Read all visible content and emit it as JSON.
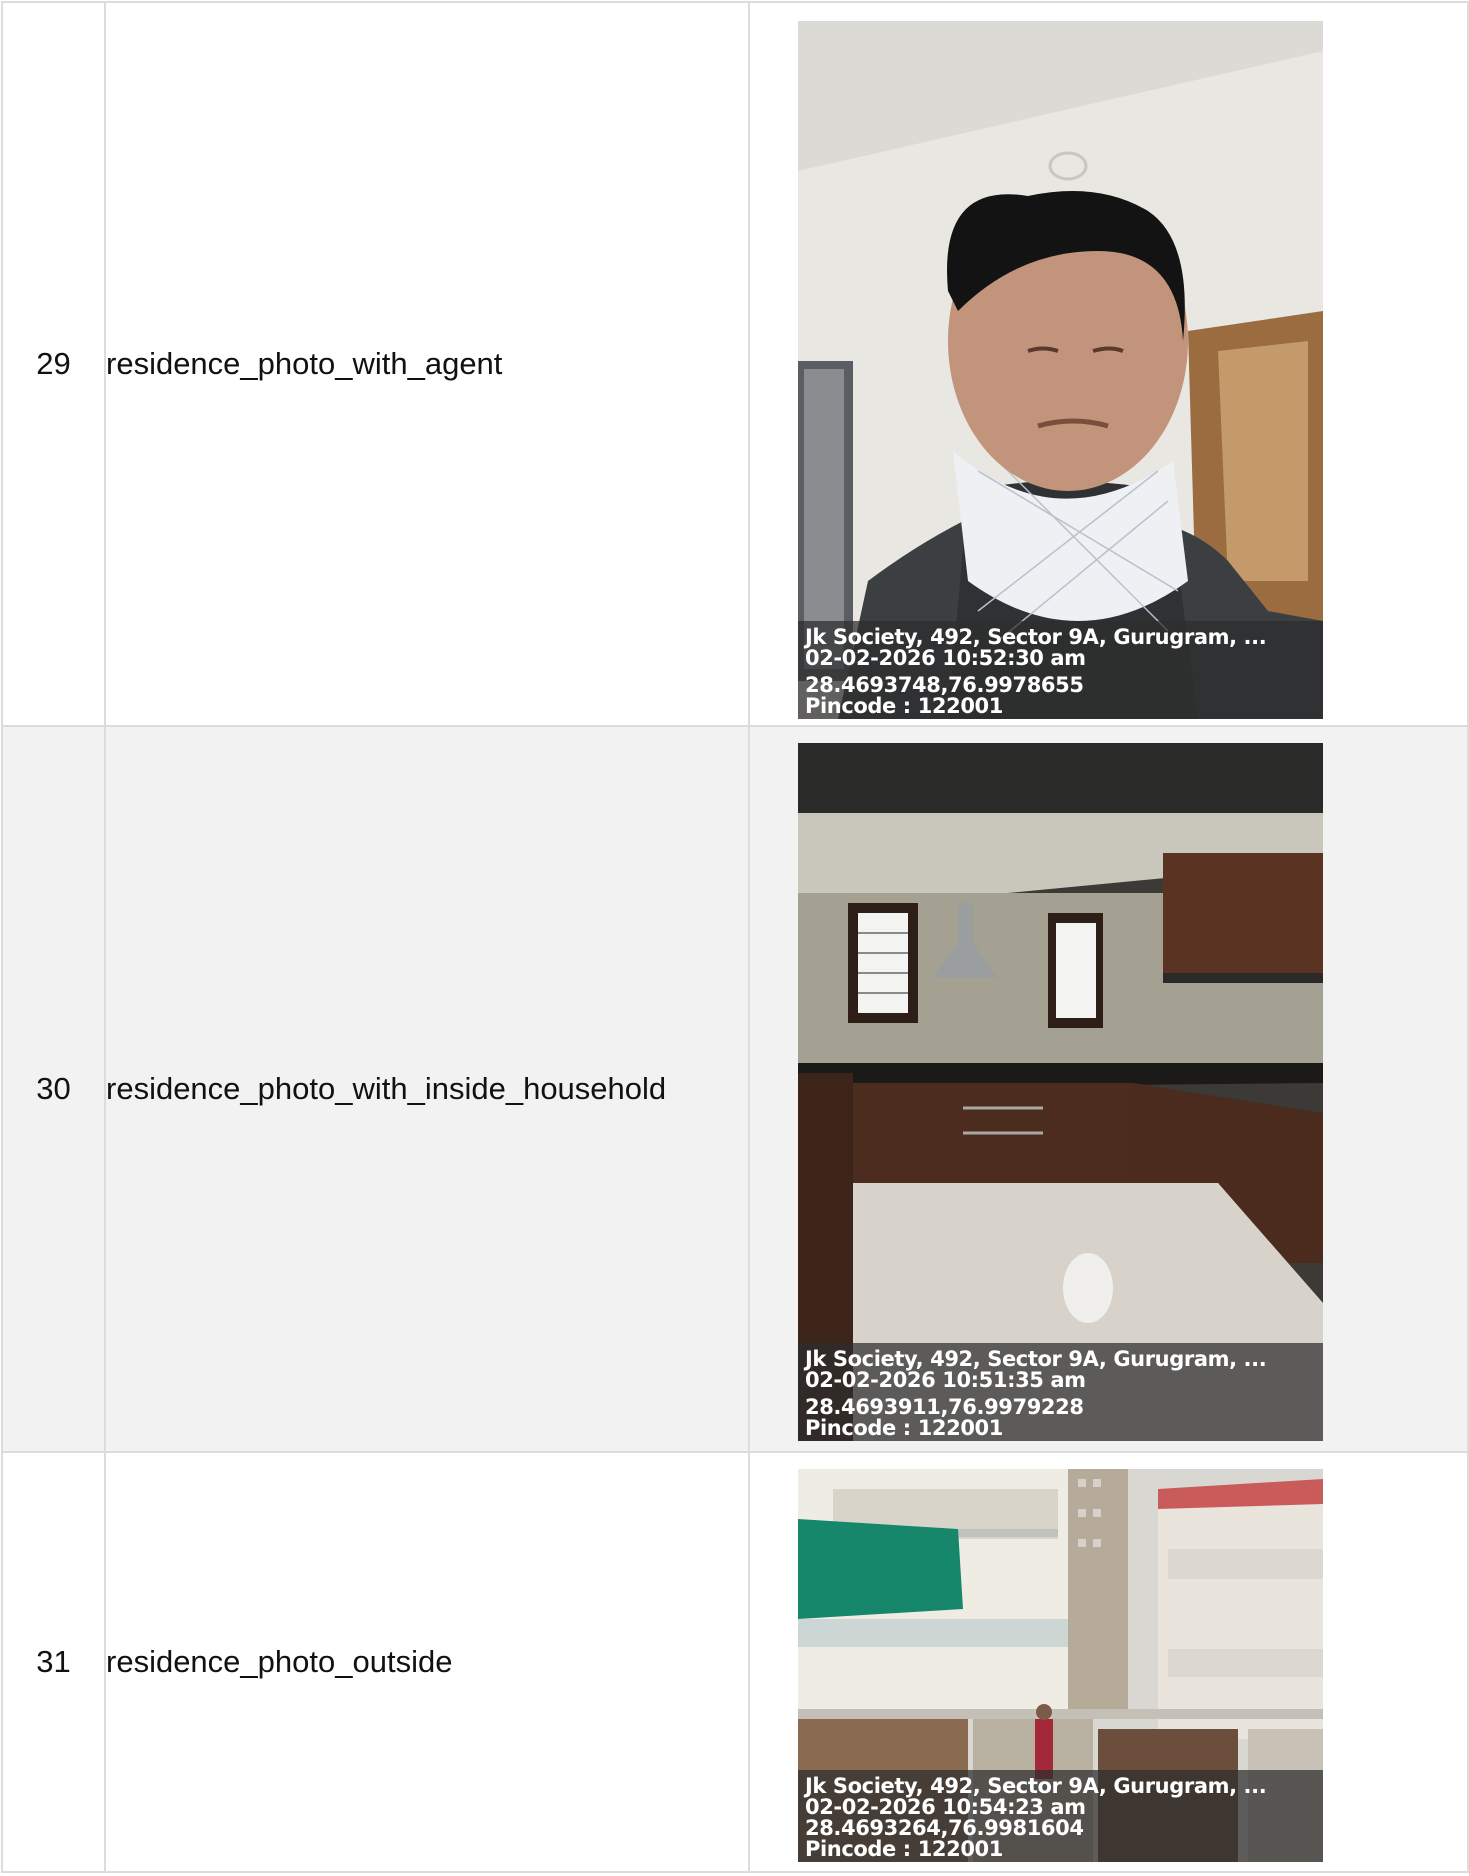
{
  "rows": [
    {
      "index": "29",
      "label": "residence_photo_with_agent",
      "stamp": {
        "address": "Jk Society, 492, Sector 9A, Gurugram, ...",
        "datetime": "02-02-2026 10:52:30 am",
        "coords": "28.4693748,76.9978655",
        "pincode": "Pincode : 122001"
      }
    },
    {
      "index": "30",
      "label": "residence_photo_with_inside_household",
      "stamp": {
        "address": "Jk Society, 492, Sector 9A, Gurugram, ...",
        "datetime": "02-02-2026 10:51:35 am",
        "coords": "28.4693911,76.9979228",
        "pincode": "Pincode : 122001"
      }
    },
    {
      "index": "31",
      "label": "residence_photo_outside",
      "stamp": {
        "address": "Jk Society, 492, Sector 9A, Gurugram, ...",
        "datetime": "02-02-2026 10:54:23 am",
        "coords": "28.4693264,76.9981604",
        "pincode": "Pincode : 122001"
      }
    }
  ]
}
